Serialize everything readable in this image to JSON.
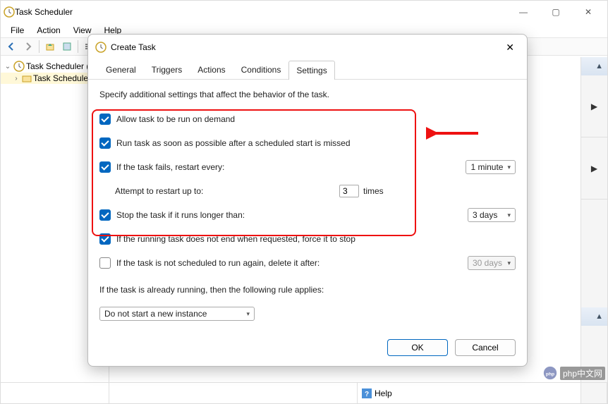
{
  "window": {
    "title": "Task Scheduler",
    "controls": {
      "min": "—",
      "max": "▢",
      "close": "✕"
    }
  },
  "menubar": [
    "File",
    "Action",
    "View",
    "Help"
  ],
  "toolbar_icons": [
    "back",
    "forward",
    "up",
    "refresh",
    "list",
    "help"
  ],
  "tree": {
    "root": "Task Scheduler (L",
    "child": "Task Schedule"
  },
  "statusbar": {
    "help": "Help"
  },
  "dialog": {
    "title": "Create Task",
    "close": "✕",
    "tabs": [
      "General",
      "Triggers",
      "Actions",
      "Conditions",
      "Settings"
    ],
    "active_tab": 4,
    "note": "Specify additional settings that affect the behavior of the task.",
    "opts": {
      "allow_on_demand": "Allow task to be run on demand",
      "run_missed": "Run task as soon as possible after a scheduled start is missed",
      "restart_every": "If the task fails, restart every:",
      "restart_value": "1 minute",
      "attempt_label": "Attempt to restart up to:",
      "attempt_value": "3",
      "attempt_suffix": "times",
      "stop_longer": "Stop the task if it runs longer than:",
      "stop_value": "3 days",
      "force_stop": "If the running task does not end when requested, force it to stop",
      "delete_after": "If the task is not scheduled to run again, delete it after:",
      "delete_value": "30 days",
      "already_running": "If the task is already running, then the following rule applies:",
      "rule_value": "Do not start a new instance"
    },
    "buttons": {
      "ok": "OK",
      "cancel": "Cancel"
    }
  },
  "watermark": "php中文网"
}
